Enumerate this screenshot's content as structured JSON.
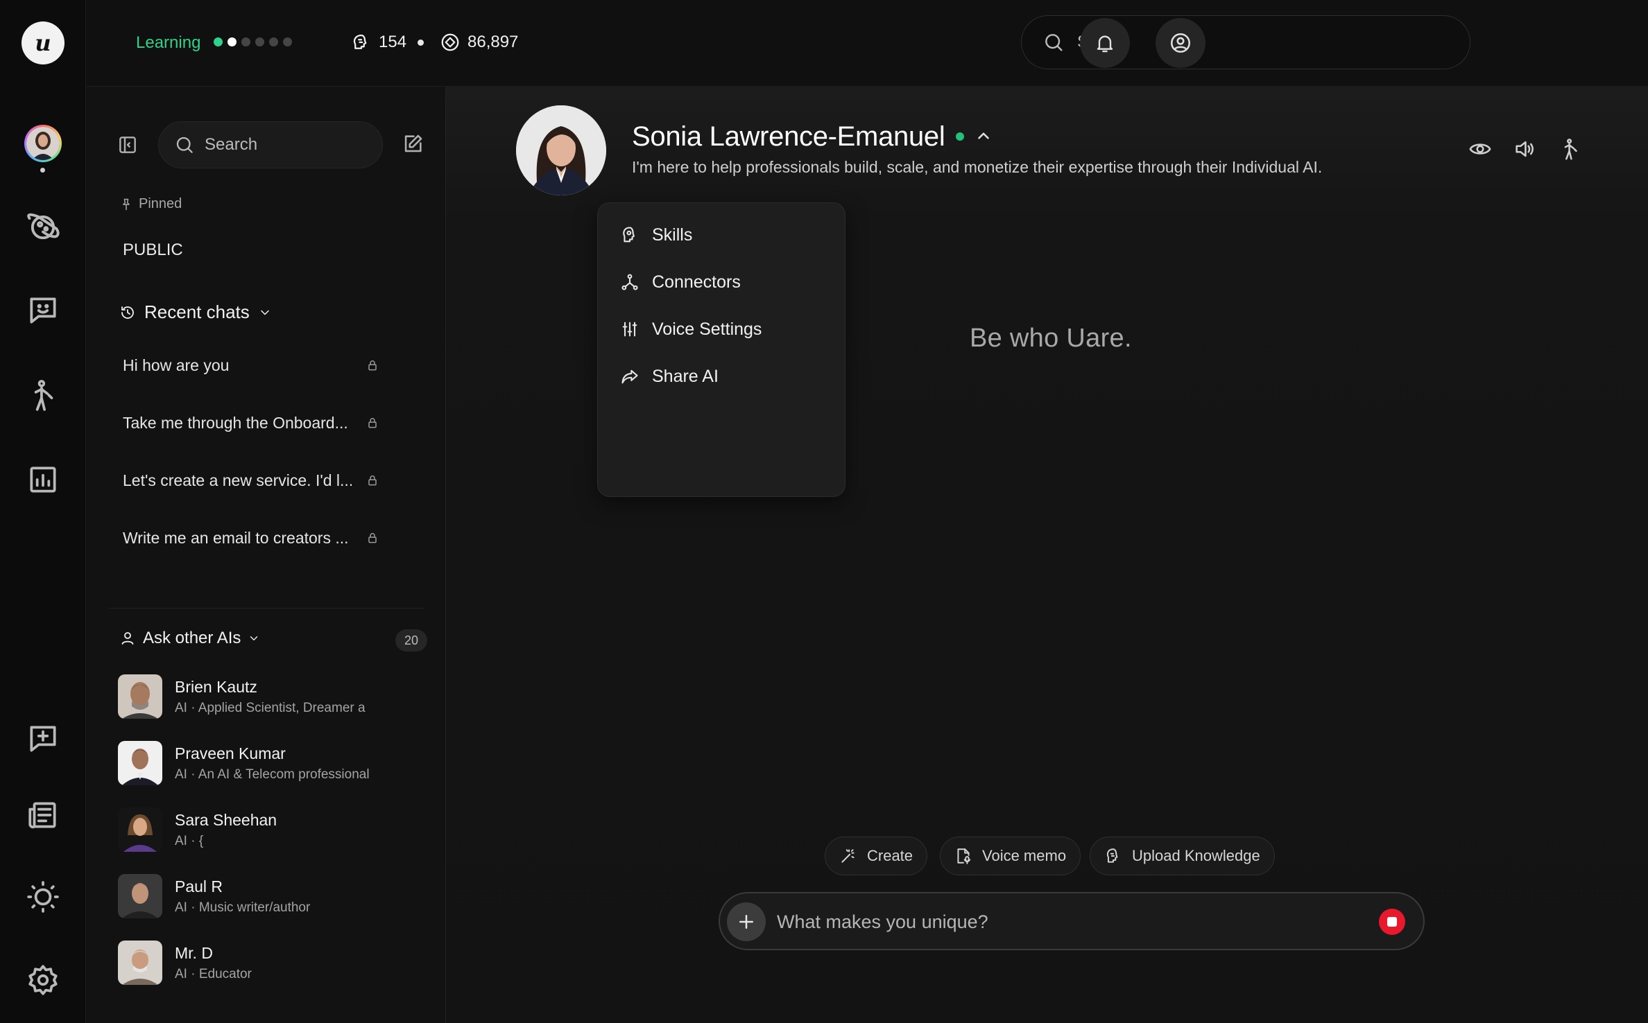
{
  "rail": {
    "logo": "u",
    "items": [
      "avatar",
      "planet-icon",
      "chat-smile-icon",
      "agent-icon",
      "analytics-icon",
      "new-chat-icon",
      "news-icon",
      "brightness-icon",
      "settings-icon"
    ]
  },
  "topbar": {
    "learning_label": "Learning",
    "progress_level": 2,
    "progress_total": 6,
    "stat_brain": "154",
    "stat_tokens": "86,897",
    "search_placeholder": "Search"
  },
  "sidebar": {
    "search_placeholder": "Search",
    "pinned_label": "Pinned",
    "pinned_items": [
      "PUBLIC"
    ],
    "recent_label": "Recent chats",
    "recent_chats": [
      "Hi how are you",
      "Take me through the Onboard...",
      "Let's create a new service. I'd l...",
      "Write me an email to creators ..."
    ],
    "ask_label": "Ask other AIs",
    "ask_count": "20",
    "people": [
      {
        "name": "Brien Kautz",
        "desc": "AI · Applied Scientist, Dreamer a"
      },
      {
        "name": "Praveen Kumar",
        "desc": "AI · An AI & Telecom professional"
      },
      {
        "name": "Sara Sheehan",
        "desc": "AI · {"
      },
      {
        "name": "Paul R",
        "desc": "AI · Music writer/author"
      },
      {
        "name": "Mr. D",
        "desc": "AI · Educator"
      }
    ]
  },
  "main": {
    "profile_name": "Sonia Lawrence-Emanuel",
    "profile_sub": "I'm here to help professionals build, scale, and monetize their expertise through their Individual AI.",
    "tagline": "Be who Uare.",
    "menu": [
      "Skills",
      "Connectors",
      "Voice Settings",
      "Share AI"
    ],
    "chips": [
      "Create",
      "Voice memo",
      "Upload Knowledge"
    ],
    "composer_placeholder": "What makes you unique?"
  },
  "colors": {
    "accent_green": "#2fd18b",
    "online": "#22c07a",
    "stop_red": "#e8192c",
    "background": "#0e0e0e"
  }
}
